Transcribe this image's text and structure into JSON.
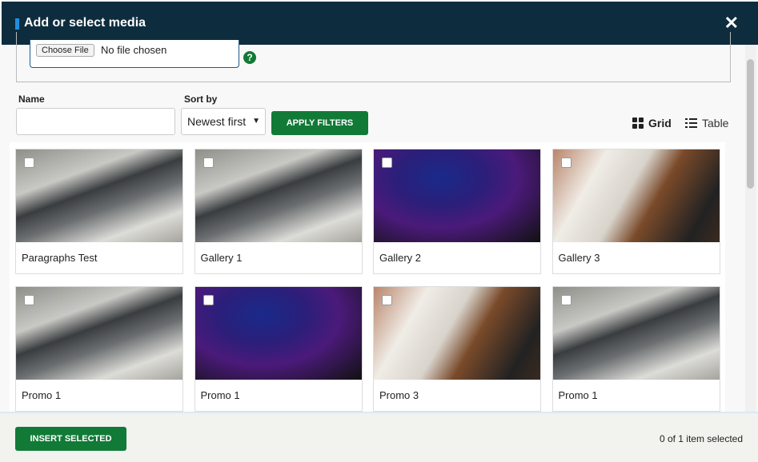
{
  "header": {
    "title": "Add or select media",
    "close_icon": "close-icon"
  },
  "upload": {
    "choose_file": "Choose File",
    "file_status": "No file chosen",
    "help": "?"
  },
  "filters": {
    "name_label": "Name",
    "name_value": "",
    "sort_label": "Sort by",
    "sort_value": "Newest first",
    "apply": "APPLY FILTERS"
  },
  "view": {
    "grid": "Grid",
    "table": "Table",
    "active": "Grid"
  },
  "media": [
    {
      "name": "Paragraphs Test",
      "image": "laptop"
    },
    {
      "name": "Gallery 1",
      "image": "laptop"
    },
    {
      "name": "Gallery 2",
      "image": "code"
    },
    {
      "name": "Gallery 3",
      "image": "desk"
    },
    {
      "name": "Promo 1",
      "image": "laptop"
    },
    {
      "name": "Promo 1",
      "image": "code"
    },
    {
      "name": "Promo 3",
      "image": "desk"
    },
    {
      "name": "Promo 1",
      "image": "laptop"
    }
  ],
  "footer": {
    "insert": "INSERT SELECTED",
    "status": "0 of 1 item selected"
  },
  "colors": {
    "header": "#0d2d3e",
    "accent": "#117a37",
    "marker": "#1e90e0"
  }
}
